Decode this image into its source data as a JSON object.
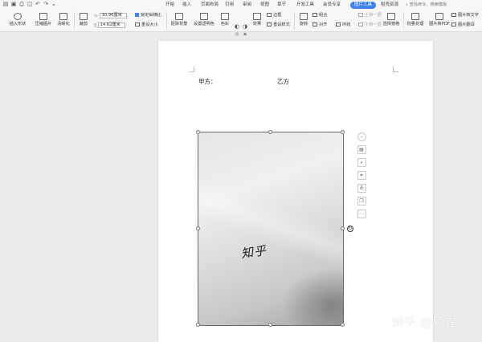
{
  "tabs": [
    {
      "label": "开始",
      "active": false
    },
    {
      "label": "插入",
      "active": false
    },
    {
      "label": "页面布局",
      "active": false
    },
    {
      "label": "引用",
      "active": false
    },
    {
      "label": "审阅",
      "active": false
    },
    {
      "label": "视图",
      "active": false
    },
    {
      "label": "章节",
      "active": false
    },
    {
      "label": "开发工具",
      "active": false
    },
    {
      "label": "会员专享",
      "active": false
    },
    {
      "label": "图片工具",
      "active": true
    },
    {
      "label": "稻壳资源",
      "active": false
    }
  ],
  "search": {
    "placeholder": "查找命令、搜索模板"
  },
  "ribbon": {
    "insert_shape": "插入形状",
    "compress": "压缩图片",
    "clarity": "清晰化",
    "crop": "裁剪",
    "width_value": "10.96厘米",
    "height_value": "14.62厘米",
    "lock_ratio": "锁定纵横比",
    "reset_size": "重设大小",
    "remove_bg": "抠除背景",
    "transparent": "设置透明色",
    "color": "色彩",
    "effects": "效果",
    "border": "边框",
    "reset_style": "重设样式",
    "rotate": "旋转",
    "combine": "组合",
    "align": "对齐",
    "wrap": "环绕",
    "up_layer": "上移一层",
    "down_layer": "下移一层",
    "select_pane": "选择窗格",
    "batch": "批量处理",
    "to_pdf": "图片转PDF",
    "to_text": "图片转文字",
    "translate": "图片翻译"
  },
  "document": {
    "party_a": "甲方：",
    "party_b": "乙方",
    "handwriting": "知乎"
  },
  "watermark": "知乎 @紫睿",
  "colors": {
    "accent": "#3b82f6"
  }
}
